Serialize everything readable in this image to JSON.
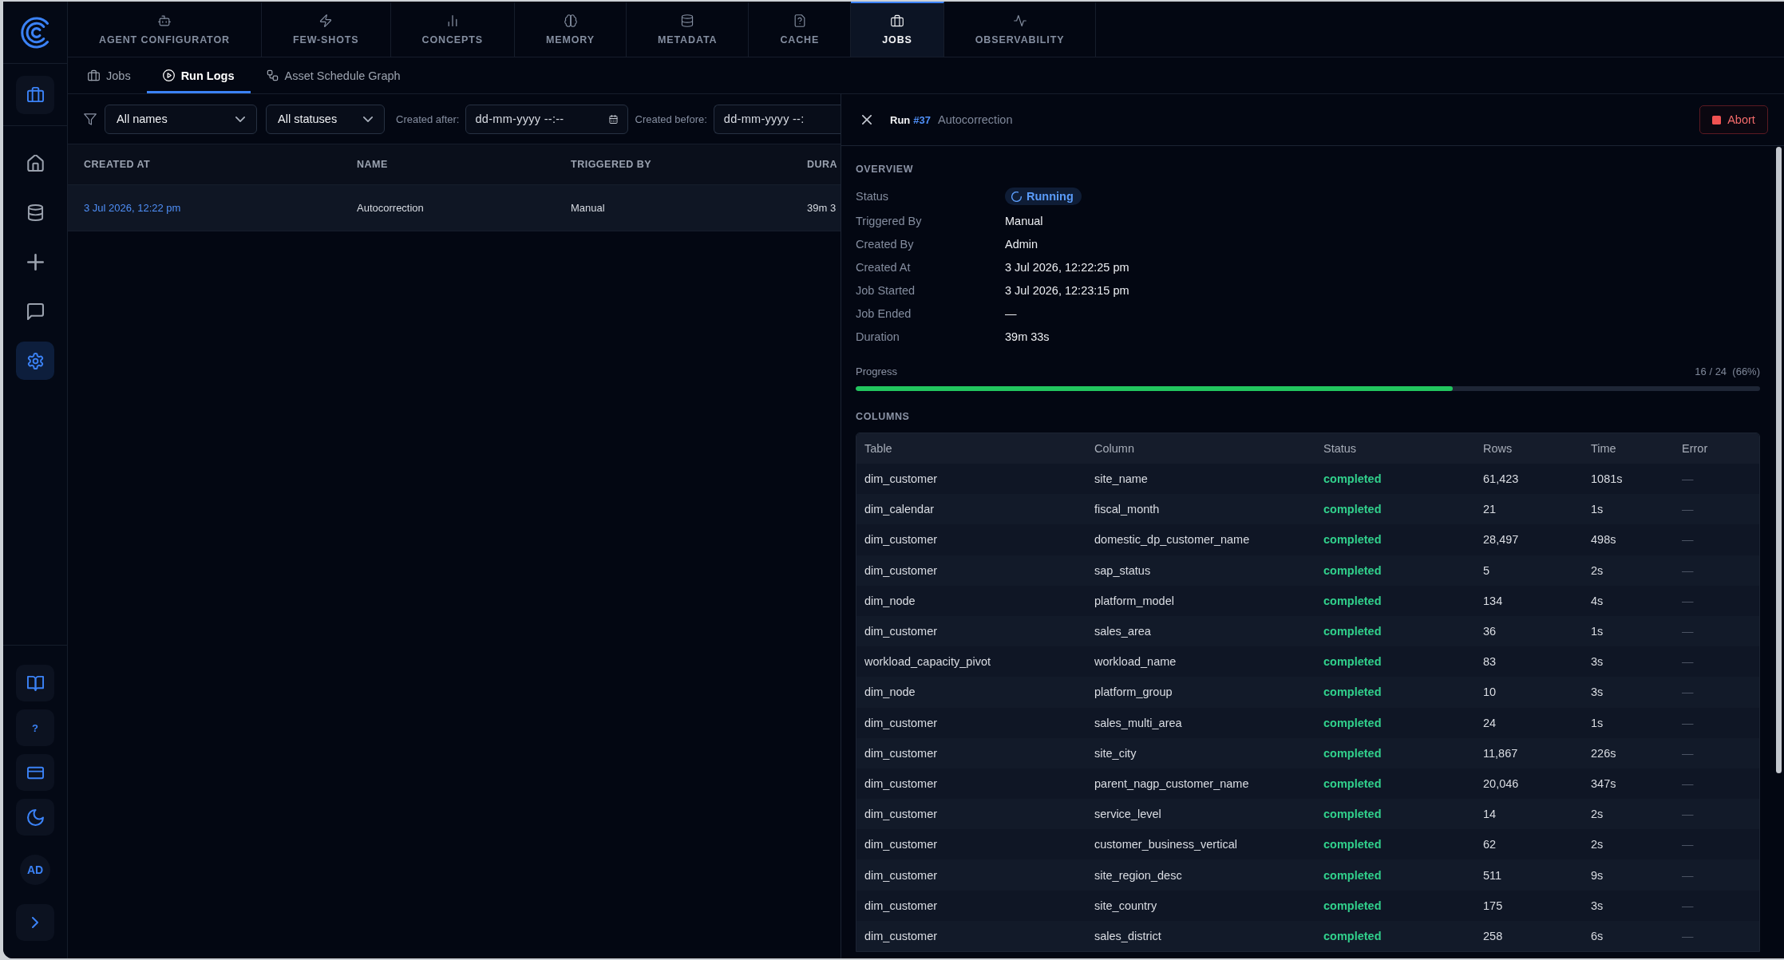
{
  "sidebar": {
    "nav_items": [
      {
        "selected": false
      },
      {
        "selected": false
      },
      {
        "selected": false
      },
      {
        "selected": false
      },
      {
        "selected": true
      }
    ],
    "help_label": "?",
    "avatar": "AD"
  },
  "nav_tabs": [
    {
      "label": "AGENT CONFIGURATOR",
      "selected": false
    },
    {
      "label": "FEW-SHOTS",
      "selected": false
    },
    {
      "label": "CONCEPTS",
      "selected": false
    },
    {
      "label": "MEMORY",
      "selected": false
    },
    {
      "label": "METADATA",
      "selected": false
    },
    {
      "label": "CACHE",
      "selected": false
    },
    {
      "label": "JOBS",
      "selected": true
    },
    {
      "label": "OBSERVABILITY",
      "selected": false
    }
  ],
  "sub_tabs": [
    {
      "label": "Jobs",
      "selected": false
    },
    {
      "label": "Run Logs",
      "selected": true
    },
    {
      "label": "Asset Schedule Graph",
      "selected": false
    }
  ],
  "filters": {
    "name_select": "All names",
    "status_select": "All statuses",
    "created_after": {
      "label": "Created after:",
      "placeholder": "dd-mm-yyyy --:--"
    },
    "created_before": {
      "label": "Created before:",
      "placeholder": "dd-mm-yyyy --:"
    }
  },
  "runs_table": {
    "columns": [
      {
        "label": "CREATED AT",
        "kind": "link"
      },
      {
        "label": "NAME",
        "kind": "text"
      },
      {
        "label": "TRIGGERED BY",
        "kind": "text"
      },
      {
        "label": "DURA",
        "kind": "text"
      }
    ],
    "rows": [
      {
        "selected": true,
        "cells": [
          "3 Jul 2026, 12:22 pm",
          "Autocorrection",
          "Manual",
          "39m 3"
        ]
      }
    ]
  },
  "run_panel": {
    "title": "Run",
    "run_number": "#37",
    "run_name": "Autocorrection",
    "abort_label": "Abort",
    "overview_title": "OVERVIEW",
    "overview": [
      {
        "label": "Status",
        "value": "Running",
        "kind": "status"
      },
      {
        "label": "Triggered By",
        "value": "Manual",
        "kind": "text"
      },
      {
        "label": "Created By",
        "value": "Admin",
        "kind": "text"
      },
      {
        "label": "Created At",
        "value": "3 Jul 2026, 12:22:25 pm",
        "kind": "text"
      },
      {
        "label": "Job Started",
        "value": "3 Jul 2026, 12:23:15 pm",
        "kind": "text"
      },
      {
        "label": "Job Ended",
        "value": "—",
        "kind": "text"
      },
      {
        "label": "Duration",
        "value": "39m 33s",
        "kind": "text"
      }
    ],
    "progress": {
      "label": "Progress",
      "reading": "16 / 24  (66%)",
      "level": 0.66
    },
    "columns_title": "COLUMNS",
    "columns_table": {
      "columns": [
        {
          "label": "Table",
          "kind": "text"
        },
        {
          "label": "Column",
          "kind": "text"
        },
        {
          "label": "Status",
          "kind": "status"
        },
        {
          "label": "Rows",
          "kind": "text"
        },
        {
          "label": "Time",
          "kind": "text"
        },
        {
          "label": "Error",
          "kind": "muted"
        }
      ],
      "rows": [
        [
          "dim_customer",
          "site_name",
          "completed",
          "61,423",
          "1081s",
          "—"
        ],
        [
          "dim_calendar",
          "fiscal_month",
          "completed",
          "21",
          "1s",
          "—"
        ],
        [
          "dim_customer",
          "domestic_dp_customer_name",
          "completed",
          "28,497",
          "498s",
          "—"
        ],
        [
          "dim_customer",
          "sap_status",
          "completed",
          "5",
          "2s",
          "—"
        ],
        [
          "dim_node",
          "platform_model",
          "completed",
          "134",
          "4s",
          "—"
        ],
        [
          "dim_customer",
          "sales_area",
          "completed",
          "36",
          "1s",
          "—"
        ],
        [
          "workload_capacity_pivot",
          "workload_name",
          "completed",
          "83",
          "3s",
          "—"
        ],
        [
          "dim_node",
          "platform_group",
          "completed",
          "10",
          "3s",
          "—"
        ],
        [
          "dim_customer",
          "sales_multi_area",
          "completed",
          "24",
          "1s",
          "—"
        ],
        [
          "dim_customer",
          "site_city",
          "completed",
          "11,867",
          "226s",
          "—"
        ],
        [
          "dim_customer",
          "parent_nagp_customer_name",
          "completed",
          "20,046",
          "347s",
          "—"
        ],
        [
          "dim_customer",
          "service_level",
          "completed",
          "14",
          "2s",
          "—"
        ],
        [
          "dim_customer",
          "customer_business_vertical",
          "completed",
          "62",
          "2s",
          "—"
        ],
        [
          "dim_customer",
          "site_region_desc",
          "completed",
          "511",
          "9s",
          "—"
        ],
        [
          "dim_customer",
          "site_country",
          "completed",
          "175",
          "3s",
          "—"
        ],
        [
          "dim_customer",
          "sales_district",
          "completed",
          "258",
          "6s",
          "—"
        ]
      ]
    }
  }
}
